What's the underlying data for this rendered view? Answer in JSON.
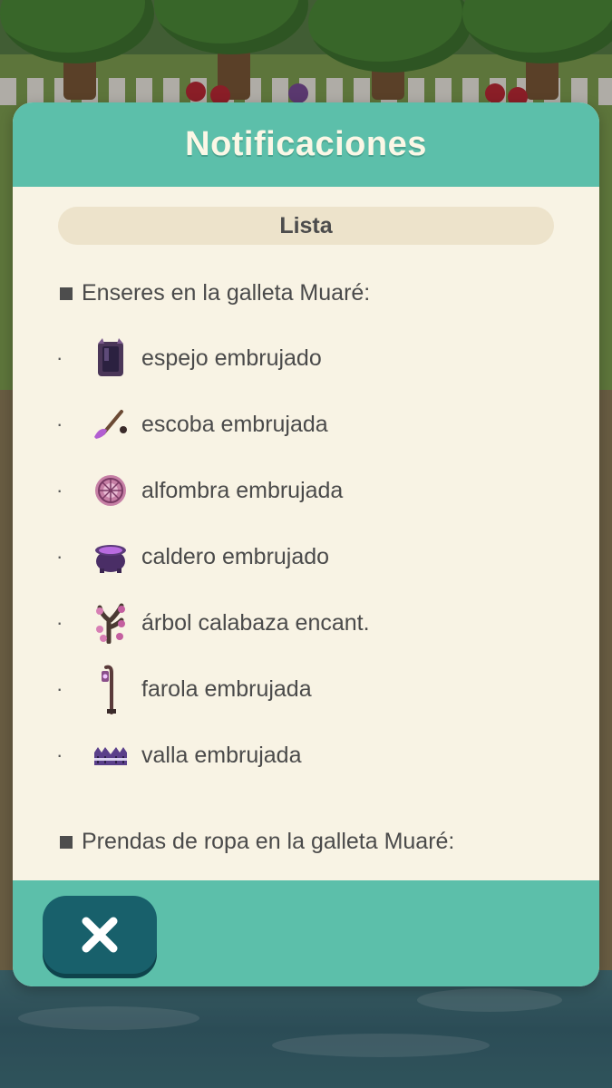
{
  "dialog": {
    "title": "Notificaciones",
    "list_label": "Lista",
    "sections": [
      {
        "heading": "Enseres en la galleta Muaré:",
        "items": [
          {
            "bullet": "·",
            "label": "espejo embrujado",
            "icon": "haunted-mirror-icon"
          },
          {
            "bullet": "·",
            "label": "escoba embrujada",
            "icon": "haunted-broom-icon"
          },
          {
            "bullet": "·",
            "label": "alfombra embrujada",
            "icon": "haunted-rug-icon"
          },
          {
            "bullet": "·",
            "label": "caldero embrujado",
            "icon": "haunted-cauldron-icon"
          },
          {
            "bullet": "·",
            "label": "árbol calabaza encant.",
            "icon": "pumpkin-tree-icon"
          },
          {
            "bullet": "·",
            "label": "farola embrujada",
            "icon": "haunted-lamppost-icon"
          },
          {
            "bullet": "·",
            "label": "valla embrujada",
            "icon": "haunted-fence-icon"
          }
        ]
      },
      {
        "heading": "Prendas de ropa en la galleta Muaré:",
        "items": []
      }
    ],
    "close_icon": "close-icon"
  },
  "colors": {
    "header_teal": "#5cbfaa",
    "panel_cream": "#f8f3e4",
    "pill_beige": "#ede3cb",
    "close_button": "#18606b"
  }
}
